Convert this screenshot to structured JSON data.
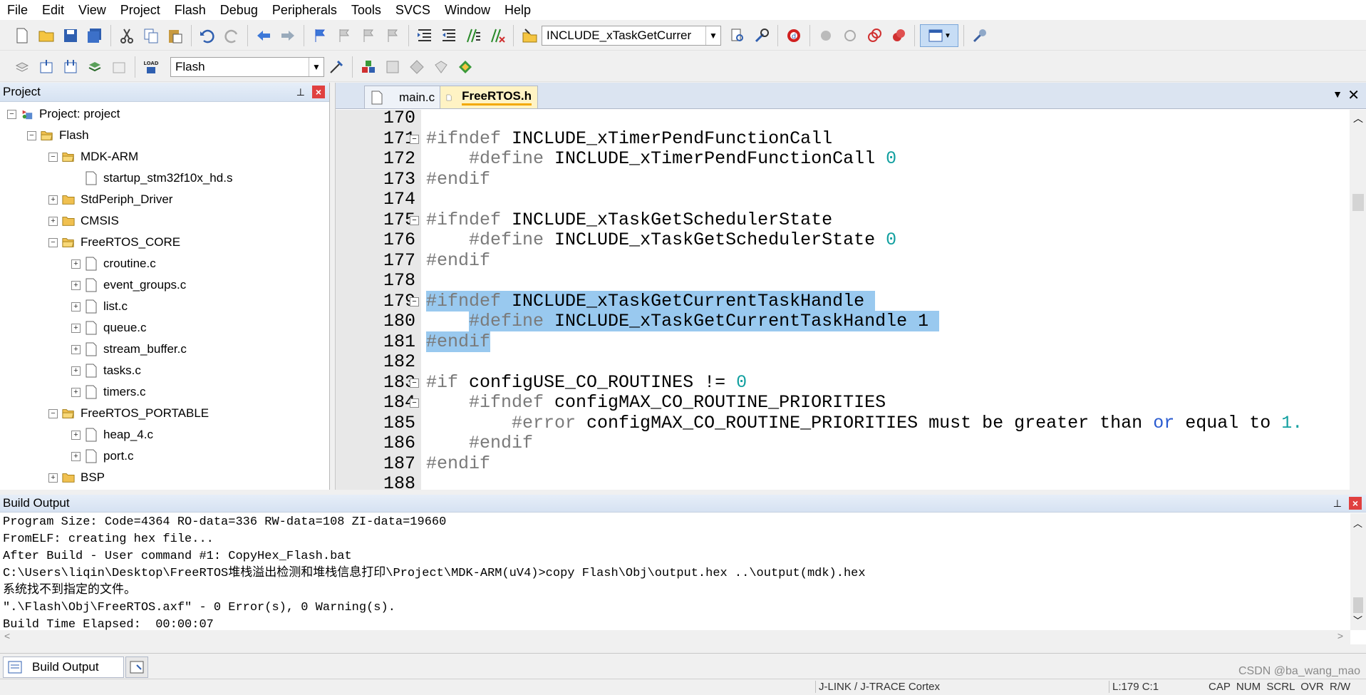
{
  "menu": [
    "File",
    "Edit",
    "View",
    "Project",
    "Flash",
    "Debug",
    "Peripherals",
    "Tools",
    "SVCS",
    "Window",
    "Help"
  ],
  "toolbar": {
    "search_value": "INCLUDE_xTaskGetCurrer",
    "target_value": "Flash"
  },
  "project": {
    "title": "Project",
    "root": "Project: project",
    "target": "Flash",
    "groups": [
      {
        "name": "MDK-ARM",
        "expanded": true,
        "files": [
          "startup_stm32f10x_hd.s"
        ]
      },
      {
        "name": "StdPeriph_Driver",
        "expanded": false,
        "files": []
      },
      {
        "name": "CMSIS",
        "expanded": false,
        "files": []
      },
      {
        "name": "FreeRTOS_CORE",
        "expanded": true,
        "files": [
          "croutine.c",
          "event_groups.c",
          "list.c",
          "queue.c",
          "stream_buffer.c",
          "tasks.c",
          "timers.c"
        ]
      },
      {
        "name": "FreeRTOS_PORTABLE",
        "expanded": true,
        "files": [
          "heap_4.c",
          "port.c"
        ]
      },
      {
        "name": "BSP",
        "expanded": false,
        "files": []
      }
    ]
  },
  "editor": {
    "tabs": [
      {
        "label": "main.c",
        "active": false
      },
      {
        "label": "FreeRTOS.h",
        "active": true
      }
    ],
    "lines": [
      {
        "n": "170",
        "segs": []
      },
      {
        "n": "171",
        "fold": true,
        "segs": [
          {
            "t": "#ifndef",
            "c": "pp"
          },
          {
            "t": " INCLUDE_xTimerPendFunctionCall"
          }
        ]
      },
      {
        "n": "172",
        "segs": [
          {
            "t": "    "
          },
          {
            "t": "#define",
            "c": "pp"
          },
          {
            "t": " INCLUDE_xTimerPendFunctionCall "
          },
          {
            "t": "0",
            "c": "num"
          }
        ]
      },
      {
        "n": "173",
        "segs": [
          {
            "t": "#endif",
            "c": "pp"
          }
        ]
      },
      {
        "n": "174",
        "segs": []
      },
      {
        "n": "175",
        "fold": true,
        "segs": [
          {
            "t": "#ifndef",
            "c": "pp"
          },
          {
            "t": " INCLUDE_xTaskGetSchedulerState"
          }
        ]
      },
      {
        "n": "176",
        "segs": [
          {
            "t": "    "
          },
          {
            "t": "#define",
            "c": "pp"
          },
          {
            "t": " INCLUDE_xTaskGetSchedulerState "
          },
          {
            "t": "0",
            "c": "num"
          }
        ]
      },
      {
        "n": "177",
        "segs": [
          {
            "t": "#endif",
            "c": "pp"
          }
        ]
      },
      {
        "n": "178",
        "segs": []
      },
      {
        "n": "179",
        "fold": true,
        "hl": true,
        "segs": [
          {
            "t": "#ifndef",
            "c": "pp"
          },
          {
            "t": " INCLUDE_xTaskGetCurrentTaskHandle "
          }
        ]
      },
      {
        "n": "180",
        "hl": true,
        "hlStart": true,
        "segs": [
          {
            "t": "    "
          },
          {
            "t": "#define",
            "c": "pp"
          },
          {
            "t": " INCLUDE_xTaskGetCurrentTaskHandle 1 "
          }
        ]
      },
      {
        "n": "181",
        "hl": true,
        "segs": [
          {
            "t": "#endif",
            "c": "pp"
          }
        ]
      },
      {
        "n": "182",
        "segs": []
      },
      {
        "n": "183",
        "fold": true,
        "segs": [
          {
            "t": "#if",
            "c": "pp"
          },
          {
            "t": " configUSE_CO_ROUTINES != "
          },
          {
            "t": "0",
            "c": "num"
          }
        ]
      },
      {
        "n": "184",
        "fold": true,
        "segs": [
          {
            "t": "    "
          },
          {
            "t": "#ifndef",
            "c": "pp"
          },
          {
            "t": " configMAX_CO_ROUTINE_PRIORITIES"
          }
        ]
      },
      {
        "n": "185",
        "segs": [
          {
            "t": "        "
          },
          {
            "t": "#error",
            "c": "pp"
          },
          {
            "t": " configMAX_CO_ROUTINE_PRIORITIES must be greater than "
          },
          {
            "t": "or",
            "c": "kw"
          },
          {
            "t": " equal to "
          },
          {
            "t": "1.",
            "c": "num"
          }
        ]
      },
      {
        "n": "186",
        "segs": [
          {
            "t": "    "
          },
          {
            "t": "#endif",
            "c": "pp"
          }
        ]
      },
      {
        "n": "187",
        "segs": [
          {
            "t": "#endif",
            "c": "pp"
          }
        ]
      },
      {
        "n": "188",
        "segs": []
      }
    ]
  },
  "build": {
    "title": "Build Output",
    "lines": [
      "Program Size: Code=4364 RO-data=336 RW-data=108 ZI-data=19660",
      "FromELF: creating hex file...",
      "After Build - User command #1: CopyHex_Flash.bat",
      "C:\\Users\\liqin\\Desktop\\FreeRTOS堆栈溢出检测和堆栈信息打印\\Project\\MDK-ARM(uV4)>copy Flash\\Obj\\output.hex ..\\output(mdk).hex",
      "系统找不到指定的文件。",
      "\".\\Flash\\Obj\\FreeRTOS.axf\" - 0 Error(s), 0 Warning(s).",
      "Build Time Elapsed:  00:00:07"
    ],
    "tab_label": "Build Output"
  },
  "status": {
    "debugger": "J-LINK / J-TRACE Cortex",
    "position": "L:179 C:1",
    "flags": "CAP  NUM  SCRL  OVR  R/W",
    "watermark": "CSDN @ba_wang_mao"
  }
}
